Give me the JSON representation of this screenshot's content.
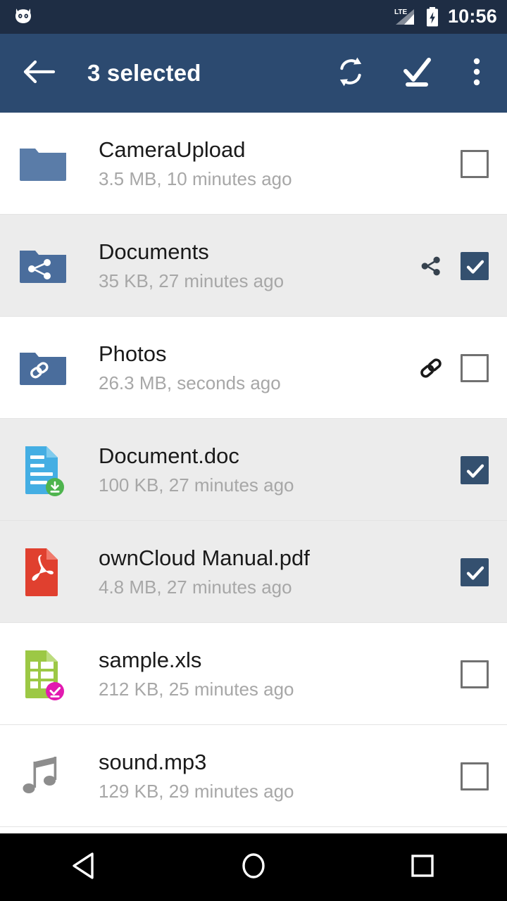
{
  "status_bar": {
    "notification_icon": "owl-icon",
    "network_label": "LTE",
    "signal_icon": "signal-bars-icon",
    "battery_icon": "battery-charging-icon",
    "clock": "10:56",
    "background_color": "#1e2d44"
  },
  "toolbar": {
    "back_icon": "back-arrow-icon",
    "title": "3 selected",
    "sync_icon": "sync-icon",
    "select_all_icon": "select-all-icon",
    "overflow_icon": "overflow-menu-icon",
    "background_color": "#2c4a70",
    "selected_count": 3
  },
  "files": [
    {
      "name": "CameraUpload",
      "details": "3.5 MB, 10 minutes ago",
      "icon": "folder-icon",
      "icon_color": "#5a7ca8",
      "badge": null,
      "share_indicator": null,
      "checked": false,
      "row_highlighted": false
    },
    {
      "name": "Documents",
      "details": "35 KB, 27 minutes ago",
      "icon": "folder-shared-icon",
      "icon_color": "#4a6d9c",
      "badge": null,
      "share_indicator": "share-icon",
      "checked": true,
      "row_highlighted": true
    },
    {
      "name": "Photos",
      "details": "26.3 MB, seconds ago",
      "icon": "folder-link-icon",
      "icon_color": "#4a6d9c",
      "badge": null,
      "share_indicator": "link-icon",
      "checked": false,
      "row_highlighted": false
    },
    {
      "name": "Document.doc",
      "details": "100 KB, 27 minutes ago",
      "icon": "doc-file-icon",
      "icon_color": "#44aee3",
      "badge": "download-badge",
      "badge_color": "#4eb44e",
      "share_indicator": null,
      "checked": true,
      "row_highlighted": true
    },
    {
      "name": "ownCloud Manual.pdf",
      "details": "4.8 MB, 27 minutes ago",
      "icon": "pdf-file-icon",
      "icon_color": "#e0402f",
      "badge": null,
      "share_indicator": null,
      "checked": true,
      "row_highlighted": true
    },
    {
      "name": "sample.xls",
      "details": "212 KB, 25 minutes ago",
      "icon": "spreadsheet-file-icon",
      "icon_color": "#9cc845",
      "badge": "synced-badge",
      "badge_color": "#e21ab0",
      "share_indicator": null,
      "checked": false,
      "row_highlighted": false
    },
    {
      "name": "sound.mp3",
      "details": "129 KB, 29 minutes ago",
      "icon": "music-note-icon",
      "icon_color": "#8d8d8d",
      "badge": null,
      "share_indicator": null,
      "checked": false,
      "row_highlighted": false
    }
  ],
  "nav_bar": {
    "back_icon": "nav-back-triangle-icon",
    "home_icon": "nav-home-circle-icon",
    "recents_icon": "nav-recents-square-icon",
    "background_color": "#000000"
  },
  "colors": {
    "accent": "#2c4a70",
    "checkbox_checked": "#34506f",
    "checkbox_unchecked": "#717171",
    "selected_row": "#ececec",
    "subtitle_text": "#a7a7a7",
    "title_text": "#1a1a1a"
  }
}
